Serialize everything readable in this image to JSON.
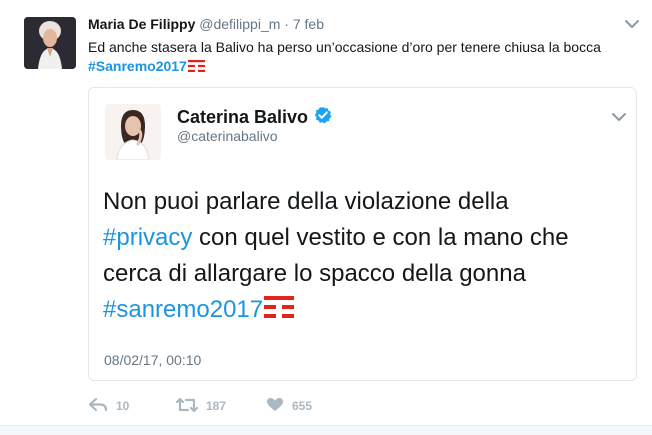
{
  "tweet": {
    "author_name": "Maria De Filippy",
    "author_handle": "@defilippi_m",
    "separator": "·",
    "date": "7 feb",
    "text": "Ed anche stasera la Balivo ha perso un’occasione d’oro per tenere chiusa la bocca",
    "hashtag": "#Sanremo2017",
    "caret_icon": "chevron-down-icon"
  },
  "quoted": {
    "author_name": "Caterina Balivo",
    "author_handle": "@caterinabalivo",
    "verified_icon": "verified-badge-icon",
    "text_line1": "Non puoi parlare della violazione della",
    "hashtag_privacy": "#privacy",
    "text_line2_rest": " con quel vestito e con la mano che",
    "text_line3": "cerca di allargare lo spacco della gonna",
    "hashtag_sanremo": "#sanremo2017",
    "timestamp": "08/02/17, 00:10"
  },
  "actions": {
    "reply_icon": "reply-icon",
    "reply_count": "10",
    "retweet_icon": "retweet-icon",
    "retweet_count": "187",
    "like_icon": "heart-icon",
    "like_count": "655"
  },
  "colors": {
    "link": "#1b95e0",
    "muted": "#657786",
    "action": "#aab8c2",
    "tim_red": "#e2231a"
  }
}
